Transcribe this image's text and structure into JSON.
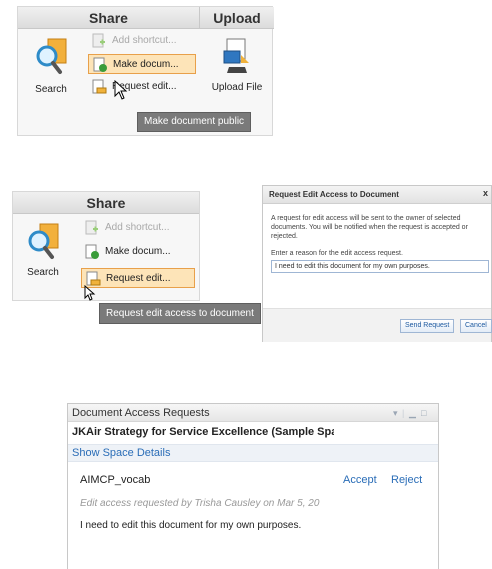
{
  "panel1": {
    "share_header": "Share",
    "upload_header": "Upload",
    "search_label": "Search",
    "upload_file_label": "Upload File",
    "add_shortcut": "Add shortcut...",
    "make_public": "Make docum...",
    "request_edit": "Request edit...",
    "tooltip": "Make document public"
  },
  "panel2": {
    "share_header": "Share",
    "search_label": "Search",
    "add_shortcut": "Add shortcut...",
    "make_public": "Make docum...",
    "request_edit": "Request edit...",
    "tooltip": "Request edit access to document"
  },
  "dialog": {
    "title": "Request Edit Access to Document",
    "close": "x",
    "body": "A request for edit access will be sent to the owner of selected documents. You will be notified when the request is accepted or rejected.",
    "prompt": "Enter a reason for the edit access request.",
    "input_value": "I need to edit this document for my own purposes.",
    "send_button": "Send Request",
    "cancel_button": "Cancel"
  },
  "requests": {
    "title": "Document Access Requests",
    "space_name": "JKAir Strategy for Service Excellence (Sample Space)",
    "show_details": "Show Space Details",
    "document_name": "AIMCP_vocab",
    "accept": "Accept",
    "reject": "Reject",
    "meta": "Edit access requested by Trisha Causley on Mar 5, 20",
    "reason": "I need to edit this document for my own purposes."
  },
  "icons": [
    "search-icon",
    "add-shortcut-icon",
    "make-public-icon",
    "request-edit-icon",
    "upload-file-icon",
    "mouse-cursor-icon"
  ]
}
